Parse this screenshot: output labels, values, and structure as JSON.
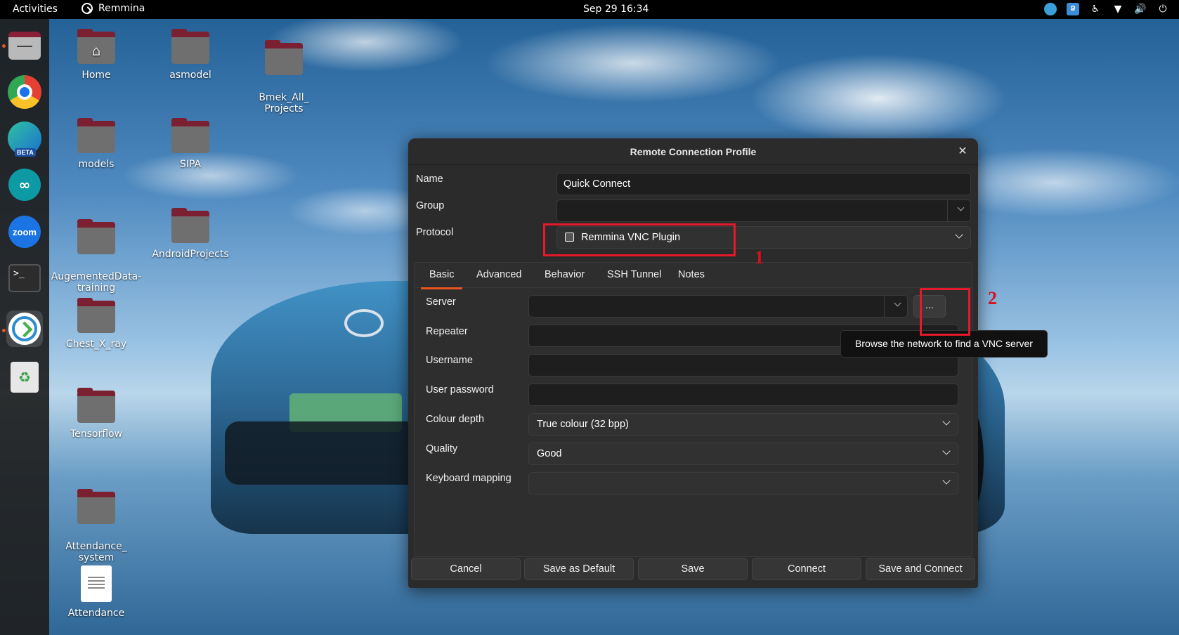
{
  "topbar": {
    "activities": "Activities",
    "app_name": "Remmina",
    "clock": "Sep 29  16:34",
    "tray_icons": [
      "remmina-tray-icon",
      "language-icon",
      "accessibility-icon",
      "wifi-icon",
      "volume-icon",
      "power-icon"
    ]
  },
  "dock": {
    "items": [
      "files",
      "chrome",
      "edge-beta",
      "arduino",
      "zoom",
      "terminal",
      "remmina",
      "trash"
    ],
    "edge_badge": "BETA",
    "zoom_label": "zoom",
    "terminal_prompt": ">_"
  },
  "desktop": {
    "icons": [
      {
        "label": "Home"
      },
      {
        "label": "asmodel"
      },
      {
        "label": "Bmek_All_\nProjects"
      },
      {
        "label": "models"
      },
      {
        "label": "SIPA"
      },
      {
        "label": "AugementedData-\ntraining"
      },
      {
        "label": "AndroidProjects"
      },
      {
        "label": "Chest_X_ray"
      },
      {
        "label": "Tensorflow"
      },
      {
        "label": "Attendance_\nsystem"
      },
      {
        "label": "Attendance"
      }
    ]
  },
  "dialog": {
    "title": "Remote Connection Profile",
    "close_glyph": "✕",
    "name_label": "Name",
    "name_value": "Quick Connect",
    "group_label": "Group",
    "group_value": "",
    "protocol_label": "Protocol",
    "protocol_value": "Remmina VNC Plugin",
    "tabs": [
      "Basic",
      "Advanced",
      "Behavior",
      "SSH Tunnel",
      "Notes"
    ],
    "active_tab": "Basic",
    "fields": {
      "server_label": "Server",
      "server_value": "",
      "browse_label": "...",
      "repeater_label": "Repeater",
      "username_label": "Username",
      "password_label": "User password",
      "colour_depth_label": "Colour depth",
      "colour_depth_value": "True colour (32 bpp)",
      "quality_label": "Quality",
      "quality_value": "Good",
      "keyboard_label": "Keyboard mapping",
      "keyboard_value": ""
    },
    "buttons": {
      "cancel": "Cancel",
      "save_default": "Save as Default",
      "save": "Save",
      "connect": "Connect",
      "save_connect": "Save and Connect"
    }
  },
  "tooltip": "Browse the network to find a VNC server",
  "annotations": {
    "one": "1",
    "two": "2",
    "color": "#e5192a"
  },
  "colors": {
    "accent": "#e95420",
    "dialog_bg": "#2b2b2b"
  }
}
